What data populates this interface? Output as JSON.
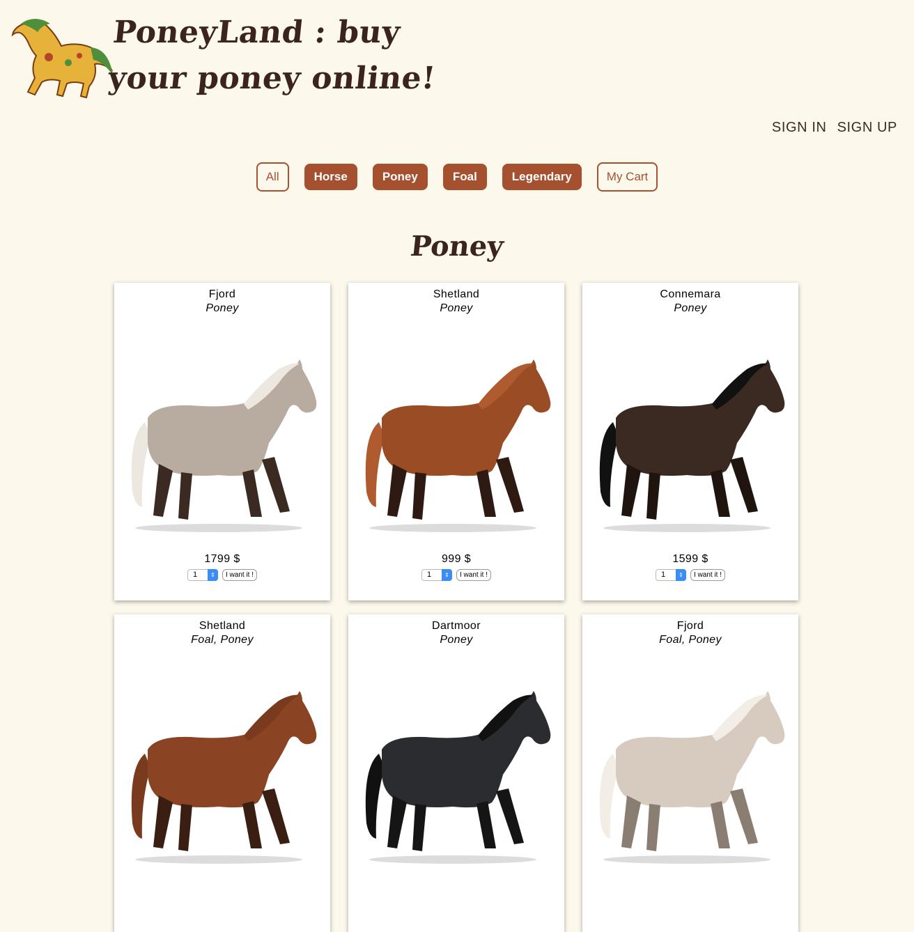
{
  "header": {
    "title": "PoneyLand : buy your poney online!"
  },
  "auth": {
    "sign_in": "SIGN IN",
    "sign_up": "SIGN UP"
  },
  "filters": [
    "All",
    "Horse",
    "Poney",
    "Foal",
    "Legendary",
    "My Cart"
  ],
  "section_title": "Poney",
  "colors": {
    "background": "#fdf8ec",
    "accent": "#a5512f",
    "title": "#3b2420"
  },
  "products": [
    {
      "name": "Fjord",
      "category": "Poney",
      "price": "1799 $",
      "qty": "1",
      "button": "I want it !",
      "coat": "#b8aca0",
      "mane": "#ece8e0",
      "legs": "#3a2a22"
    },
    {
      "name": "Shetland",
      "category": "Poney",
      "price": "999 $",
      "qty": "1",
      "button": "I want it !",
      "coat": "#9a4c25",
      "mane": "#b05a30",
      "legs": "#2e1a12"
    },
    {
      "name": "Connemara",
      "category": "Poney",
      "price": "1599 $",
      "qty": "1",
      "button": "I want it !",
      "coat": "#3a2a22",
      "mane": "#111111",
      "legs": "#20140f"
    },
    {
      "name": "Shetland",
      "category": "Foal, Poney",
      "price": "",
      "qty": "",
      "button": "",
      "coat": "#8a4424",
      "mane": "#7a3a1e",
      "legs": "#3a1e12"
    },
    {
      "name": "Dartmoor",
      "category": "Poney",
      "price": "",
      "qty": "",
      "button": "",
      "coat": "#2a2c30",
      "mane": "#111111",
      "legs": "#151515"
    },
    {
      "name": "Fjord",
      "category": "Foal, Poney",
      "price": "",
      "qty": "",
      "button": "",
      "coat": "#d6cbbe",
      "mane": "#f2eee6",
      "legs": "#8a7d72"
    }
  ]
}
